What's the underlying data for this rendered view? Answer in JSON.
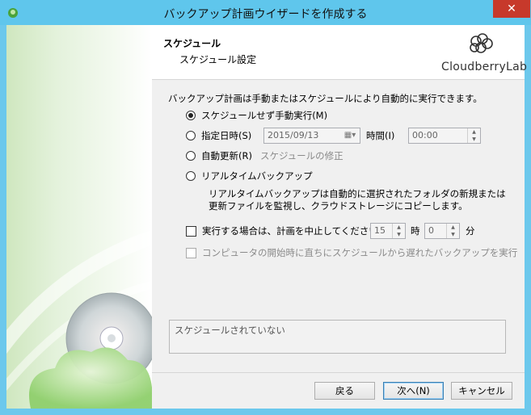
{
  "window": {
    "title": "バックアップ計画ウイザードを作成する",
    "close_label": "✕"
  },
  "header": {
    "title": "スケジュール",
    "subtitle": "スケジュール設定",
    "logo_text": "CloudberryLab"
  },
  "content": {
    "description": "バックアップ計画は手動またはスケジュールにより自動的に実行できます。",
    "options": {
      "manual": {
        "label": "スケジュールせず手動実行(M)",
        "selected": true
      },
      "specific_date": {
        "label": "指定日時(S)",
        "selected": false,
        "date_value": "2015/09/13",
        "time_label": "時間(I)",
        "time_value": "00:00"
      },
      "recurring": {
        "label": "自動更新(R)",
        "selected": false,
        "edit_link": "スケジュールの修正"
      },
      "realtime": {
        "label": "リアルタイムバックアップ",
        "selected": false,
        "note": "リアルタイムバックアップは自動的に選択されたフォルダの新規または更新ファイルを監視し、クラウドストレージにコピーします。"
      }
    },
    "stop_if_runs": {
      "label": "実行する場合は、計画を中止してください。",
      "checked": false,
      "hours_value": "15",
      "hours_unit": "時",
      "minutes_value": "0",
      "minutes_unit": "分"
    },
    "run_missed": {
      "label": "コンピュータの開始時に直ちにスケジュールから遅れたバックアップを実行",
      "checked": false,
      "enabled": false
    },
    "status_text": "スケジュールされていない"
  },
  "footer": {
    "back_label": "戻る",
    "next_label": "次へ(N)",
    "cancel_label": "キャンセル"
  },
  "colors": {
    "titlebar": "#5fc6ec",
    "close_button": "#c7392b",
    "primary_border": "#3c7fb1"
  }
}
